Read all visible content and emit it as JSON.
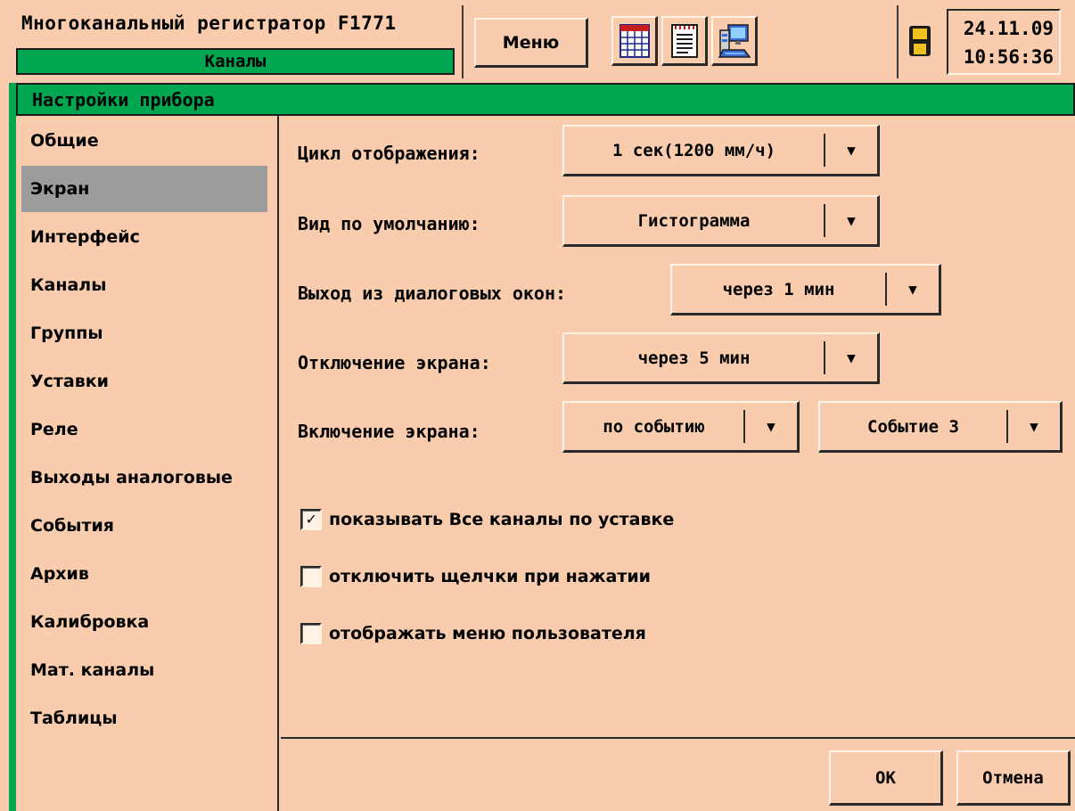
{
  "topbar": {
    "app_title": "Многоканальный регистратор F1771",
    "current_screen": "Каналы",
    "menu_label": "Меню",
    "tools": [
      {
        "icon": "table-icon"
      },
      {
        "icon": "document-icon"
      },
      {
        "icon": "computer-settings-icon"
      }
    ],
    "storage_icon": "floppy-disk-icon",
    "date": "24.11.09",
    "time": "10:56:36"
  },
  "dialog": {
    "title": "Настройки прибора",
    "sidebar": [
      {
        "label": "Общие",
        "selected": false
      },
      {
        "label": "Экран",
        "selected": true
      },
      {
        "label": "Интерфейс",
        "selected": false
      },
      {
        "label": "Каналы",
        "selected": false
      },
      {
        "label": "Группы",
        "selected": false
      },
      {
        "label": "Уставки",
        "selected": false
      },
      {
        "label": "Реле",
        "selected": false
      },
      {
        "label": "Выходы аналоговые",
        "selected": false
      },
      {
        "label": "События",
        "selected": false
      },
      {
        "label": "Архив",
        "selected": false
      },
      {
        "label": "Калибровка",
        "selected": false
      },
      {
        "label": "Мат. каналы",
        "selected": false
      },
      {
        "label": "Таблицы",
        "selected": false
      }
    ],
    "settings": {
      "display_cycle": {
        "label": "Цикл отображения:",
        "value": "1 сек(1200 мм/ч)"
      },
      "default_view": {
        "label": "Вид по умолчанию:",
        "value": "Гистограмма"
      },
      "dialog_exit": {
        "label": "Выход из диалоговых окон:",
        "value": "через 1 мин"
      },
      "screen_off": {
        "label": "Отключение экрана:",
        "value": "через 5 мин"
      },
      "screen_on": {
        "label": "Включение экрана:",
        "value": "по событию",
        "event_value": "Событие 3"
      }
    },
    "checkboxes": [
      {
        "label": "показывать Все каналы по уставке",
        "checked": true
      },
      {
        "label": "отключить щелчки при нажатии",
        "checked": false
      },
      {
        "label": "отображать меню пользователя",
        "checked": false
      }
    ],
    "buttons": {
      "ok": "ОК",
      "cancel": "Отмена"
    }
  },
  "colors": {
    "background": "#f8ccac",
    "accent_green": "#00a650",
    "selection_gray": "#9c9c9c"
  }
}
